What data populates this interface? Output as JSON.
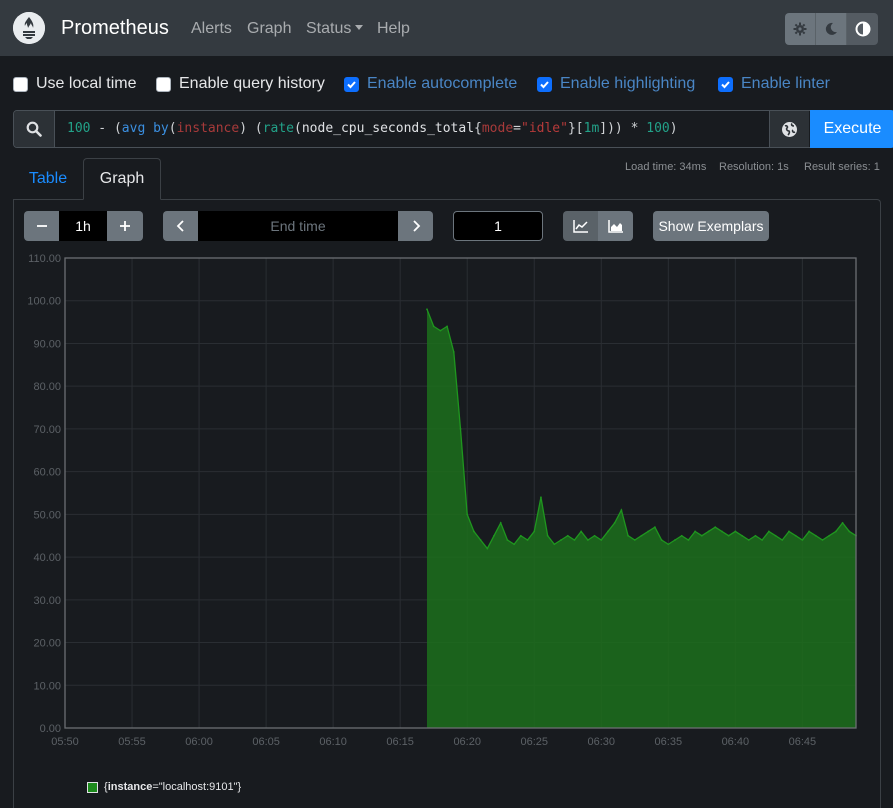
{
  "navbar": {
    "brand": "Prometheus",
    "links": {
      "alerts": "Alerts",
      "graph": "Graph",
      "status": "Status",
      "help": "Help"
    }
  },
  "options": {
    "use_local_time": {
      "label": "Use local time",
      "checked": false
    },
    "query_history": {
      "label": "Enable query history",
      "checked": false
    },
    "autocomplete": {
      "label": "Enable autocomplete",
      "checked": true
    },
    "highlighting": {
      "label": "Enable highlighting",
      "checked": true
    },
    "linter": {
      "label": "Enable linter",
      "checked": true
    }
  },
  "query": {
    "tokens": [
      {
        "text": "100",
        "kind": "num"
      },
      {
        "text": " - (",
        "kind": "op"
      },
      {
        "text": "avg",
        "kind": "kw"
      },
      {
        "text": " ",
        "kind": "op"
      },
      {
        "text": "by",
        "kind": "kw"
      },
      {
        "text": "(",
        "kind": "op"
      },
      {
        "text": "instance",
        "kind": "lbl"
      },
      {
        "text": ") (",
        "kind": "op"
      },
      {
        "text": "rate",
        "kind": "fn"
      },
      {
        "text": "(",
        "kind": "op"
      },
      {
        "text": "node_cpu_seconds_total",
        "kind": "met"
      },
      {
        "text": "{",
        "kind": "op"
      },
      {
        "text": "mode",
        "kind": "lbl"
      },
      {
        "text": "=",
        "kind": "op"
      },
      {
        "text": "\"idle\"",
        "kind": "str"
      },
      {
        "text": "}[",
        "kind": "op"
      },
      {
        "text": "1m",
        "kind": "num"
      },
      {
        "text": "])) * ",
        "kind": "op"
      },
      {
        "text": "100",
        "kind": "num"
      },
      {
        "text": ")",
        "kind": "op"
      }
    ],
    "execute_label": "Execute"
  },
  "tabs": {
    "table": "Table",
    "graph": "Graph"
  },
  "stats": {
    "load_time": "Load time: 34ms",
    "resolution": "Resolution: 1s",
    "result_series": "Result series: 1"
  },
  "controls": {
    "range": "1h",
    "end_time_placeholder": "End time",
    "resolution_value": "1",
    "exemplars_label": "Show Exemplars"
  },
  "colors": {
    "accent": "#1a8cff",
    "series_fill": "#1c6e1c",
    "series_line": "#1f961f"
  },
  "chart_data": {
    "type": "area",
    "title": "",
    "xlabel": "",
    "ylabel": "",
    "ylim": [
      0,
      110
    ],
    "xlim": [
      "05:50",
      "06:49"
    ],
    "y_ticks": [
      "0.00",
      "10.00",
      "20.00",
      "30.00",
      "40.00",
      "50.00",
      "60.00",
      "70.00",
      "80.00",
      "90.00",
      "100.00",
      "110.00"
    ],
    "x_ticks": [
      "05:50",
      "05:55",
      "06:00",
      "06:05",
      "06:10",
      "06:15",
      "06:20",
      "06:25",
      "06:30",
      "06:35",
      "06:40",
      "06:45"
    ],
    "grid": true,
    "legend_position": "bottom-left",
    "series": [
      {
        "name": "{instance=\"localhost:9101\"}",
        "x": [
          "06:17",
          "06:17.5",
          "06:18",
          "06:18.5",
          "06:19",
          "06:19.5",
          "06:20",
          "06:20.5",
          "06:21",
          "06:21.5",
          "06:22",
          "06:22.5",
          "06:23",
          "06:23.5",
          "06:24",
          "06:24.5",
          "06:25",
          "06:25.5",
          "06:26",
          "06:26.5",
          "06:27",
          "06:27.5",
          "06:28",
          "06:28.5",
          "06:29",
          "06:29.5",
          "06:30",
          "06:30.5",
          "06:31",
          "06:31.5",
          "06:32",
          "06:32.5",
          "06:33",
          "06:33.5",
          "06:34",
          "06:34.5",
          "06:35",
          "06:35.5",
          "06:36",
          "06:36.5",
          "06:37",
          "06:37.5",
          "06:38",
          "06:38.5",
          "06:39",
          "06:39.5",
          "06:40",
          "06:40.5",
          "06:41",
          "06:41.5",
          "06:42",
          "06:42.5",
          "06:43",
          "06:43.5",
          "06:44",
          "06:44.5",
          "06:45",
          "06:45.5",
          "06:46",
          "06:46.5",
          "06:47",
          "06:47.5",
          "06:48",
          "06:48.5",
          "06:49"
        ],
        "values": [
          98,
          94,
          93,
          94,
          88,
          70,
          50,
          46,
          44,
          42,
          45,
          48,
          44,
          43,
          45,
          44,
          46,
          54,
          45,
          43,
          44,
          45,
          44,
          46,
          44,
          45,
          44,
          46,
          48,
          51,
          45,
          44,
          45,
          46,
          47,
          44,
          43,
          44,
          45,
          44,
          46,
          45,
          46,
          47,
          46,
          45,
          46,
          45,
          44,
          45,
          44,
          46,
          45,
          44,
          46,
          45,
          44,
          46,
          45,
          44,
          45,
          46,
          48,
          46,
          45
        ]
      }
    ]
  },
  "legend": {
    "key": "instance",
    "value": "\"localhost:9101\""
  }
}
